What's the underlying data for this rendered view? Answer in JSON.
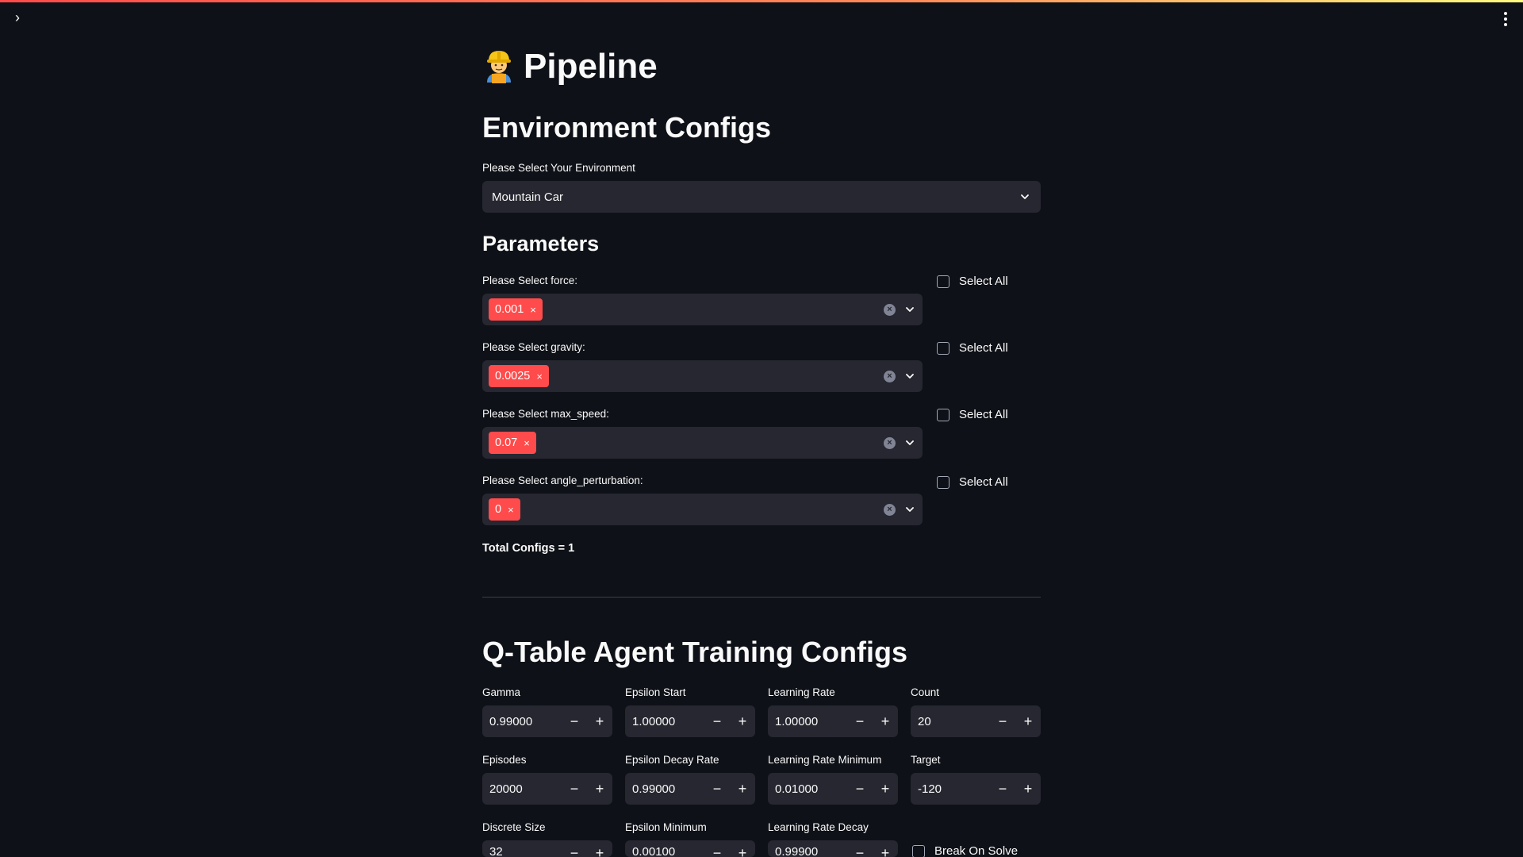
{
  "page": {
    "title": "Pipeline",
    "title_emoji": "construction-worker-emoji",
    "accent_color": "#ff4b4b",
    "background_color": "#0e1117",
    "input_background": "#262730"
  },
  "environment": {
    "heading": "Environment Configs",
    "select_label": "Please Select Your Environment",
    "selected_value": "Mountain Car"
  },
  "parameters": {
    "heading": "Parameters",
    "items": [
      {
        "label": "Please Select force:",
        "chip": "0.001",
        "select_all_label": "Select All",
        "select_all_checked": false
      },
      {
        "label": "Please Select gravity:",
        "chip": "0.0025",
        "select_all_label": "Select All",
        "select_all_checked": false
      },
      {
        "label": "Please Select max_speed:",
        "chip": "0.07",
        "select_all_label": "Select All",
        "select_all_checked": false
      },
      {
        "label": "Please Select angle_perturbation:",
        "chip": "0",
        "select_all_label": "Select All",
        "select_all_checked": false
      }
    ],
    "total_configs": "Total Configs = 1"
  },
  "training": {
    "heading": "Q-Table Agent Training Configs",
    "fields": [
      {
        "label": "Gamma",
        "value": "0.99000"
      },
      {
        "label": "Epsilon Start",
        "value": "1.00000"
      },
      {
        "label": "Learning Rate",
        "value": "1.00000"
      },
      {
        "label": "Count",
        "value": "20"
      },
      {
        "label": "Episodes",
        "value": "20000"
      },
      {
        "label": "Epsilon Decay Rate",
        "value": "0.99000"
      },
      {
        "label": "Learning Rate Minimum",
        "value": "0.01000"
      },
      {
        "label": "Target",
        "value": "-120"
      },
      {
        "label": "Discrete Size",
        "value": "32"
      },
      {
        "label": "Epsilon Minimum",
        "value": "0.00100"
      },
      {
        "label": "Learning Rate Decay",
        "value": "0.99900"
      }
    ],
    "break_on_solve_label": "Break On Solve",
    "break_on_solve_checked": false,
    "minus_glyph": "−",
    "plus_glyph": "+"
  },
  "icons": {
    "sidebar_toggle": "chevron-right-icon",
    "main_menu": "kebab-menu-icon",
    "chip_remove": "close-icon",
    "clear": "clear-circle-icon",
    "dropdown": "chevron-down-icon",
    "chevron_right_glyph": "›",
    "close_glyph": "×",
    "clear_glyph": "×"
  }
}
